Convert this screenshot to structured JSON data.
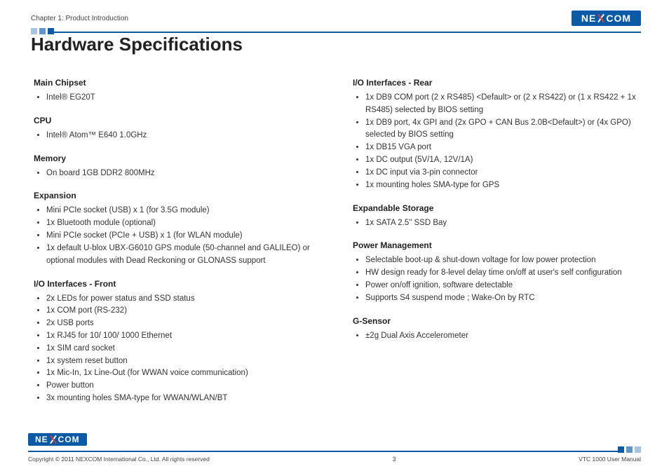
{
  "header": {
    "chapter": "Chapter 1: Product Introduction",
    "brand_pre": "NE",
    "brand_post": "COM"
  },
  "title": "Hardware Specifications",
  "left_sections": [
    {
      "heading": "Main Chipset",
      "items": [
        "Intel® EG20T"
      ]
    },
    {
      "heading": "CPU",
      "items": [
        "Intel® Atom™ E640 1.0GHz"
      ]
    },
    {
      "heading": "Memory",
      "items": [
        "On board 1GB DDR2 800MHz"
      ]
    },
    {
      "heading": "Expansion",
      "items": [
        "Mini PCIe socket (USB) x 1 (for 3.5G module)",
        "1x Bluetooth module (optional)",
        "Mini PCIe socket (PCIe + USB) x 1 (for WLAN module)",
        "1x default U-blox UBX-G6010 GPS module (50-channel and GALILEO) or optional modules with Dead Reckoning or GLONASS support"
      ]
    },
    {
      "heading": "I/O Interfaces - Front",
      "items": [
        "2x LEDs for power status and SSD status",
        "1x COM port (RS-232)",
        "2x USB ports",
        "1x RJ45 for 10/ 100/ 1000 Ethernet",
        "1x SIM card socket",
        "1x system reset button",
        "1x Mic-In, 1x Line-Out (for WWAN voice communication)",
        "Power button",
        "3x mounting holes SMA-type for WWAN/WLAN/BT"
      ]
    }
  ],
  "right_sections": [
    {
      "heading": "I/O Interfaces - Rear",
      "items": [
        "1x DB9 COM port (2 x RS485) <Default> or (2 x RS422) or (1 x RS422 + 1x RS485) selected by BIOS setting",
        "1x DB9 port, 4x GPI and (2x GPO + CAN Bus 2.0B<Default>) or (4x GPO) selected by BIOS setting",
        "1x DB15 VGA port",
        "1x DC output (5V/1A, 12V/1A)",
        "1x DC input via 3-pin connector",
        "1x mounting holes SMA-type for GPS"
      ]
    },
    {
      "heading": "Expandable Storage",
      "items": [
        "1x SATA 2.5\" SSD Bay"
      ]
    },
    {
      "heading": "Power Management",
      "items": [
        "Selectable boot-up & shut-down voltage for low power protection",
        "HW design ready for 8-level delay time on/off at user's self configuration",
        "Power on/off ignition, software detectable",
        "Supports S4 suspend mode ; Wake-On by RTC"
      ]
    },
    {
      "heading": "G-Sensor",
      "items": [
        "±2g Dual Axis Accelerometer"
      ]
    }
  ],
  "footer": {
    "copyright": "Copyright © 2011 NEXCOM International Co., Ltd. All rights reserved",
    "page": "3",
    "doc": "VTC 1000 User Manual"
  }
}
